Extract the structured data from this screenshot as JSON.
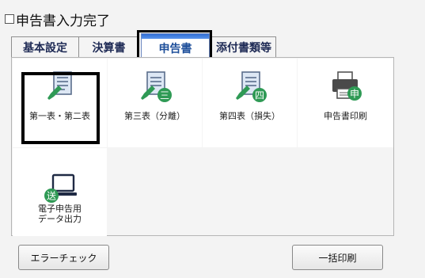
{
  "header": {
    "completion_checkbox_label": "申告書入力完了",
    "completion_checked": false
  },
  "tabs": [
    {
      "label": "基本設定",
      "active": false
    },
    {
      "label": "決算書",
      "active": false
    },
    {
      "label": "申告書",
      "active": true
    },
    {
      "label": "添付書類等",
      "active": false
    }
  ],
  "tiles": [
    {
      "label": "第一表・第二表",
      "icon": "document-pen-icon",
      "badge": ""
    },
    {
      "label": "第三表（分離）",
      "icon": "document-pen-icon",
      "badge": "三"
    },
    {
      "label": "第四表（損失）",
      "icon": "document-pen-icon",
      "badge": "四"
    },
    {
      "label": "申告書印刷",
      "icon": "printer-icon",
      "badge": "申"
    },
    {
      "label": "電子申告用\nデータ出力",
      "icon": "monitor-send-icon",
      "badge": "送"
    }
  ],
  "buttons": {
    "error_check": "エラーチェック",
    "batch_print": "一括印刷"
  },
  "colors": {
    "tab_active_bar": "#2f6ed6",
    "icon_green": "#2f9a55",
    "doc_blue": "#dde7f4",
    "doc_border": "#5b6e8c"
  }
}
